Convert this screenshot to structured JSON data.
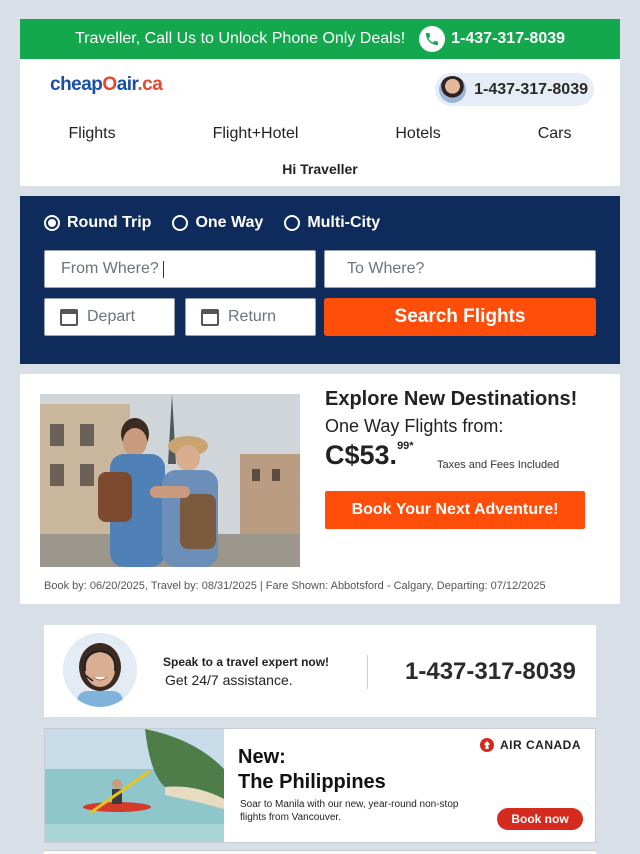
{
  "promo_bar": {
    "text": "Traveller, Call Us to Unlock Phone Only Deals!",
    "phone": "1-437-317-8039",
    "bg_color": "#14a84e"
  },
  "header": {
    "logo_part1": "cheap",
    "logo_part2": "O",
    "logo_part3": "air",
    "logo_part4": ".ca",
    "phone": "1-437-317-8039",
    "greeting": "Hi Traveller"
  },
  "nav": {
    "items": [
      "Flights",
      "Flight+Hotel",
      "Hotels",
      "Cars"
    ]
  },
  "search": {
    "trip_types": [
      "Round Trip",
      "One Way",
      "Multi-City"
    ],
    "selected_trip": "Round Trip",
    "from_placeholder": "From Where?",
    "to_placeholder": "To Where?",
    "depart_placeholder": "Depart",
    "return_placeholder": "Return",
    "button": "Search Flights",
    "panel_color": "#0e2b5c",
    "accent_color": "#ff4e0a"
  },
  "deal": {
    "title": "Explore New Destinations!",
    "subtitle": "One Way Flights from:",
    "price_main": "C$53.",
    "price_cents": "99*",
    "taxes_note": "Taxes and Fees Included",
    "button": "Book Your Next Adventure!",
    "terms": "Book by: 06/20/2025, Travel by: 08/31/2025  | Fare Shown: Abbotsford - Calgary, Departing: 07/12/2025"
  },
  "expert": {
    "line1": "Speak to a travel expert now!",
    "line2": "Get 24/7 assistance.",
    "phone": "1-437-317-8039"
  },
  "ad": {
    "headline1": "New:",
    "headline2": "The Philippines",
    "body": "Soar to Manila with our new, year-round non-stop flights from Vancouver.",
    "brand": "AIR CANADA",
    "button": "Book now",
    "brand_color": "#d52b1e"
  }
}
